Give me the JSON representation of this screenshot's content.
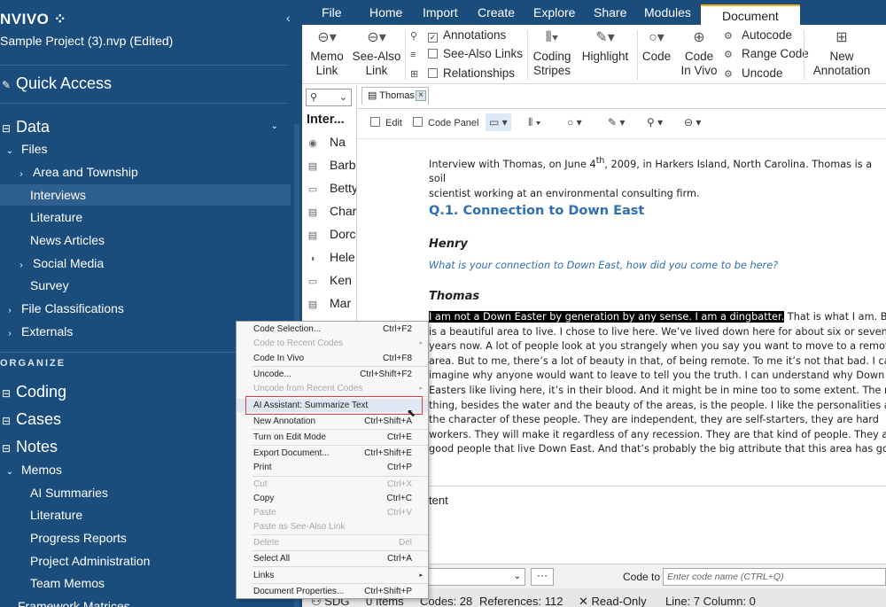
{
  "nav": {
    "brand": "NVIVO",
    "project": "Sample Project (3).nvp (Edited)",
    "quick_access": "Quick Access",
    "data": "Data",
    "files": "Files",
    "area_township": "Area and Township",
    "interviews": "Interviews",
    "literature": "Literature",
    "news_articles": "News Articles",
    "social_media": "Social Media",
    "survey": "Survey",
    "file_classifications": "File Classifications",
    "externals": "Externals",
    "organize": "ORGANIZE",
    "coding": "Coding",
    "cases": "Cases",
    "notes": "Notes",
    "memos": "Memos",
    "ai_summaries": "AI Summaries",
    "memo_literature": "Literature",
    "progress_reports": "Progress Reports",
    "project_administration": "Project Administration",
    "team_memos": "Team Memos",
    "framework_matrices": "Framework Matrices"
  },
  "ribbon": {
    "tabs": [
      "File",
      "Home",
      "Import",
      "Create",
      "Explore",
      "Share",
      "Modules",
      "Document"
    ],
    "memo_link": [
      "Memo",
      "Link"
    ],
    "see_also_link": [
      "See-Also",
      "Link"
    ],
    "annotations": "Annotations",
    "see_also_links": "See-Also Links",
    "relationships": "Relationships",
    "coding_stripes": [
      "Coding",
      "Stripes"
    ],
    "highlight": "Highlight",
    "code": "Code",
    "code_in_vivo": [
      "Code",
      "In Vivo"
    ],
    "autocode": "Autocode",
    "range_code": "Range Code",
    "uncode": "Uncode",
    "new_annotation": [
      "New",
      "Annotation"
    ]
  },
  "list": {
    "header": "Inter...",
    "items": [
      "Na",
      "Barb",
      "Betty",
      "Char",
      "Dorc",
      "Hele",
      "Ken",
      "Mar"
    ]
  },
  "doc": {
    "tab": "Thomas",
    "edit": "Edit",
    "code_panel": "Code Panel",
    "intro_a": "Interview with Thomas, on June 4",
    "intro_sup": "th",
    "intro_b": ", 2009, in Harkers Island, North Carolina. Thomas is a soil",
    "intro_c": "scientist working at an environmental consulting firm.",
    "heading": "Q.1. Connection to Down East",
    "speaker1": "Henry",
    "question": "What is your connection to Down East, how did you come to be here?",
    "speaker2": "Thomas",
    "highlighted": "I am not a Down Easter by generation by any sense. I am a dingbatter.",
    "line1_rest": " That is what I am. But it",
    "lines": [
      "is a beautiful area to live. I chose to live here. We’ve lived down here for about six or seven",
      "years now. A lot of people look at you strangely when you say you want to move to a remote",
      "area. But to me, there’s a lot of beauty in that, of being remote. To me it’s not that bad. I can’t",
      "imagine why anyone would want to leave to tell you the truth. I can understand why Down",
      "Easters like living here, it’s in their blood. And it might be in mine too to some extent. The main",
      "thing, besides the water and the beauty of the areas, is the people. I like the personalities and",
      "the character of these people. They are independent, they are self-starters, they are hard",
      "workers. They will make it regardless of any recession. They are that kind of people. They are",
      "good people that live Down East. And that’s probably the big attribute that this area has got."
    ],
    "below_text": "tent"
  },
  "codebar": {
    "dots": "···",
    "code_to": "Code to",
    "placeholder": "Enter code name (CTRL+Q)"
  },
  "status": {
    "user": "SDG",
    "items": "0 Items",
    "codes": "Codes: 28",
    "references": "References: 112",
    "read_only": "Read-Only",
    "position": "Line: 7 Column: 0"
  },
  "menu": [
    {
      "label": "Code Selection...",
      "shortcut": "Ctrl+F2",
      "disabled": false,
      "arrow": false
    },
    {
      "label": "Code to Recent Codes",
      "shortcut": "",
      "disabled": true,
      "arrow": true
    },
    {
      "label": "Code In Vivo",
      "shortcut": "Ctrl+F8",
      "disabled": false,
      "arrow": false
    },
    {
      "label": "Uncode...",
      "shortcut": "Ctrl+Shift+F2",
      "disabled": false,
      "arrow": false
    },
    {
      "label": "Uncode from Recent Codes",
      "shortcut": "",
      "disabled": true,
      "arrow": true
    },
    {
      "label": "AI Assistant: Summarize Text",
      "shortcut": "",
      "disabled": false,
      "arrow": false
    },
    {
      "label": "New Annotation",
      "shortcut": "Ctrl+Shift+A",
      "disabled": false,
      "arrow": false
    },
    {
      "label": "Turn on Edit Mode",
      "shortcut": "Ctrl+E",
      "disabled": false,
      "arrow": false
    },
    {
      "label": "Export Document...",
      "shortcut": "Ctrl+Shift+E",
      "disabled": false,
      "arrow": false
    },
    {
      "label": "Print",
      "shortcut": "Ctrl+P",
      "disabled": false,
      "arrow": false
    },
    {
      "label": "Cut",
      "shortcut": "Ctrl+X",
      "disabled": true,
      "arrow": false
    },
    {
      "label": "Copy",
      "shortcut": "Ctrl+C",
      "disabled": false,
      "arrow": false
    },
    {
      "label": "Paste",
      "shortcut": "Ctrl+V",
      "disabled": true,
      "arrow": false
    },
    {
      "label": "Paste as See-Also Link",
      "shortcut": "",
      "disabled": true,
      "arrow": false
    },
    {
      "label": "Delete",
      "shortcut": "Del",
      "disabled": true,
      "arrow": false
    },
    {
      "label": "Select All",
      "shortcut": "Ctrl+A",
      "disabled": false,
      "arrow": false
    },
    {
      "label": "Links",
      "shortcut": "",
      "disabled": false,
      "arrow": true
    },
    {
      "label": "Document Properties...",
      "shortcut": "Ctrl+Shift+P",
      "disabled": false,
      "arrow": false
    }
  ]
}
